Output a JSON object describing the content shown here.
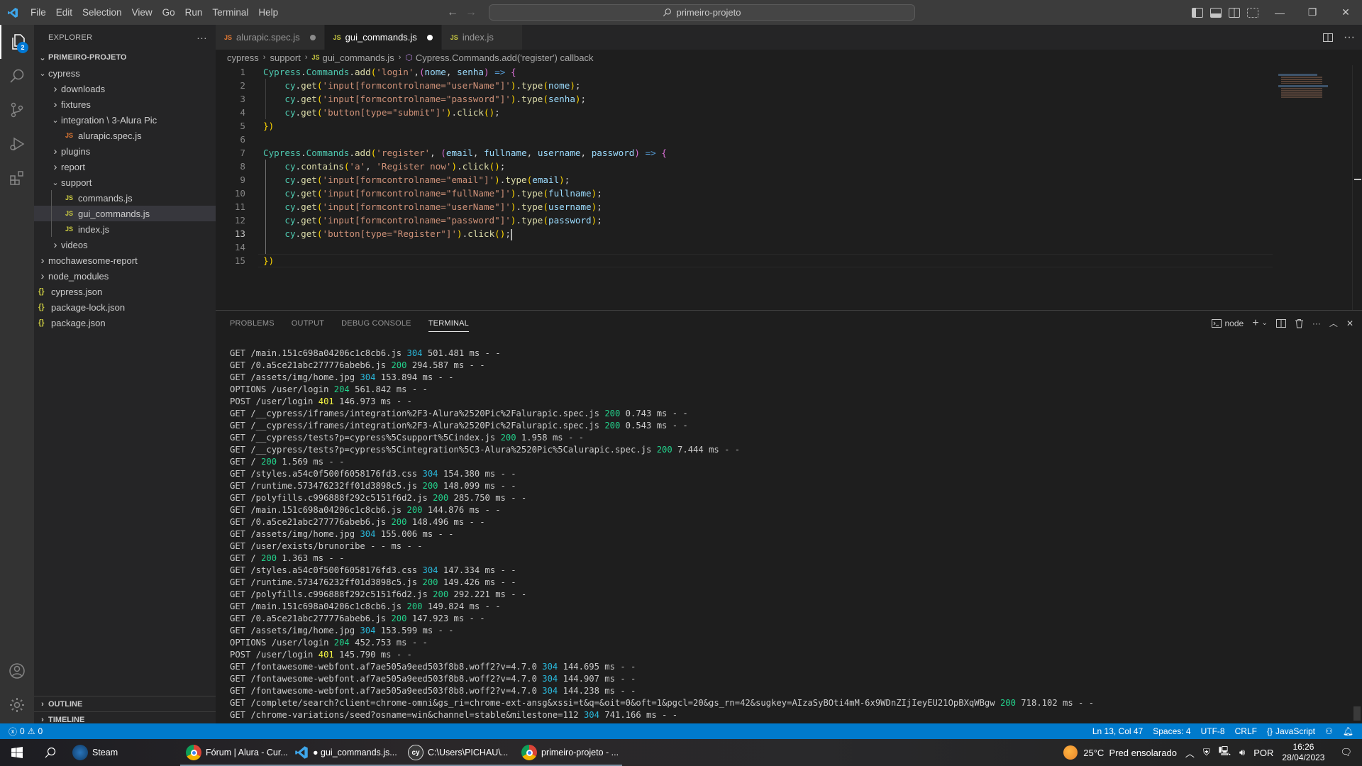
{
  "titlebar": {
    "menu": [
      "File",
      "Edit",
      "Selection",
      "View",
      "Go",
      "Run",
      "Terminal",
      "Help"
    ],
    "search_text": "primeiro-projeto"
  },
  "activity": {
    "explorer_badge": "2"
  },
  "sidebar": {
    "title": "EXPLORER",
    "more": "···",
    "root": "PRIMEIRO-PROJETO",
    "tree": [
      {
        "label": "cypress",
        "type": "folder-open",
        "depth": 1
      },
      {
        "label": "downloads",
        "type": "folder",
        "depth": 2
      },
      {
        "label": "fixtures",
        "type": "folder",
        "depth": 2
      },
      {
        "label": "integration \\ 3-Alura Pic",
        "type": "folder-open",
        "depth": 2
      },
      {
        "label": "alurapic.spec.js",
        "type": "js-orange",
        "depth": 3
      },
      {
        "label": "plugins",
        "type": "folder",
        "depth": 2
      },
      {
        "label": "report",
        "type": "folder",
        "depth": 2
      },
      {
        "label": "support",
        "type": "folder-open",
        "depth": 2
      },
      {
        "label": "commands.js",
        "type": "js",
        "depth": 3
      },
      {
        "label": "gui_commands.js",
        "type": "js",
        "depth": 3,
        "selected": true
      },
      {
        "label": "index.js",
        "type": "js",
        "depth": 3
      },
      {
        "label": "videos",
        "type": "folder",
        "depth": 2
      },
      {
        "label": "mochawesome-report",
        "type": "folder",
        "depth": 1
      },
      {
        "label": "node_modules",
        "type": "folder",
        "depth": 1
      },
      {
        "label": "cypress.json",
        "type": "json",
        "depth": 1
      },
      {
        "label": "package-lock.json",
        "type": "json",
        "depth": 1
      },
      {
        "label": "package.json",
        "type": "json",
        "depth": 1
      }
    ],
    "outline": "OUTLINE",
    "timeline": "TIMELINE"
  },
  "editor": {
    "tabs": [
      {
        "label": "alurapic.spec.js",
        "modified": true,
        "active": false,
        "icon": "orange"
      },
      {
        "label": "gui_commands.js",
        "modified": true,
        "active": true,
        "icon": "yellow"
      },
      {
        "label": "index.js",
        "modified": false,
        "active": false,
        "icon": "yellow"
      }
    ],
    "breadcrumb": [
      "cypress",
      "support",
      "gui_commands.js",
      "Cypress.Commands.add('register') callback"
    ],
    "current_line": 13,
    "lines": [
      "Cypress.Commands.add('login',(nome, senha) => {",
      "    cy.get('input[formcontrolname=\"userName\"]').type(nome);",
      "    cy.get('input[formcontrolname=\"password\"]').type(senha);",
      "    cy.get('button[type=\"submit\"]').click();",
      "})",
      "",
      "Cypress.Commands.add('register', (email, fullname, username, password) => {",
      "    cy.contains('a', 'Register now').click();",
      "    cy.get('input[formcontrolname=\"email\"]').type(email);",
      "    cy.get('input[formcontrolname=\"fullName\"]').type(fullname);",
      "    cy.get('input[formcontrolname=\"userName\"]').type(username);",
      "    cy.get('input[formcontrolname=\"password\"]').type(password);",
      "    cy.get('button[type=\"Register\"]').click();",
      "",
      "})"
    ]
  },
  "panel": {
    "tabs": [
      "PROBLEMS",
      "OUTPUT",
      "DEBUG CONSOLE",
      "TERMINAL"
    ],
    "active_tab": "TERMINAL",
    "terminal_name": "node",
    "terminal_lines": [
      {
        "pre": "GET /main.151c698a04206c1c8cb6.js ",
        "status": "304",
        "post": " 501.481 ms - -"
      },
      {
        "pre": "GET /0.a5ce21abc277776abeb6.js ",
        "status": "200",
        "post": " 294.587 ms - -"
      },
      {
        "pre": "GET /assets/img/home.jpg ",
        "status": "304",
        "post": " 153.894 ms - -"
      },
      {
        "pre": "OPTIONS /user/login ",
        "status": "204",
        "post": " 561.842 ms - -"
      },
      {
        "pre": "POST /user/login ",
        "status": "401",
        "post": " 146.973 ms - -"
      },
      {
        "pre": "GET /__cypress/iframes/integration%2F3-Alura%2520Pic%2Falurapic.spec.js ",
        "status": "200",
        "post": " 0.743 ms - -"
      },
      {
        "pre": "GET /__cypress/iframes/integration%2F3-Alura%2520Pic%2Falurapic.spec.js ",
        "status": "200",
        "post": " 0.543 ms - -"
      },
      {
        "pre": "GET /__cypress/tests?p=cypress%5Csupport%5Cindex.js ",
        "status": "200",
        "post": " 1.958 ms - -"
      },
      {
        "pre": "GET /__cypress/tests?p=cypress%5Cintegration%5C3-Alura%2520Pic%5Calurapic.spec.js ",
        "status": "200",
        "post": " 7.444 ms - -"
      },
      {
        "pre": "GET / ",
        "status": "200",
        "post": " 1.569 ms - -"
      },
      {
        "pre": "GET /styles.a54c0f500f6058176fd3.css ",
        "status": "304",
        "post": " 154.380 ms - -"
      },
      {
        "pre": "GET /runtime.573476232ff01d3898c5.js ",
        "status": "200",
        "post": " 148.099 ms - -"
      },
      {
        "pre": "GET /polyfills.c996888f292c5151f6d2.js ",
        "status": "200",
        "post": " 285.750 ms - -"
      },
      {
        "pre": "GET /main.151c698a04206c1c8cb6.js ",
        "status": "200",
        "post": " 144.876 ms - -"
      },
      {
        "pre": "GET /0.a5ce21abc277776abeb6.js ",
        "status": "200",
        "post": " 148.496 ms - -"
      },
      {
        "pre": "GET /assets/img/home.jpg ",
        "status": "304",
        "post": " 155.006 ms - -"
      },
      {
        "pre": "GET /user/exists/brunoribe - - ms - -",
        "status": "",
        "post": ""
      },
      {
        "pre": "GET / ",
        "status": "200",
        "post": " 1.363 ms - -"
      },
      {
        "pre": "GET /styles.a54c0f500f6058176fd3.css ",
        "status": "304",
        "post": " 147.334 ms - -"
      },
      {
        "pre": "GET /runtime.573476232ff01d3898c5.js ",
        "status": "200",
        "post": " 149.426 ms - -"
      },
      {
        "pre": "GET /polyfills.c996888f292c5151f6d2.js ",
        "status": "200",
        "post": " 292.221 ms - -"
      },
      {
        "pre": "GET /main.151c698a04206c1c8cb6.js ",
        "status": "200",
        "post": " 149.824 ms - -"
      },
      {
        "pre": "GET /0.a5ce21abc277776abeb6.js ",
        "status": "200",
        "post": " 147.923 ms - -"
      },
      {
        "pre": "GET /assets/img/home.jpg ",
        "status": "304",
        "post": " 153.599 ms - -"
      },
      {
        "pre": "OPTIONS /user/login ",
        "status": "204",
        "post": " 452.753 ms - -"
      },
      {
        "pre": "POST /user/login ",
        "status": "401",
        "post": " 145.790 ms - -"
      },
      {
        "pre": "GET /fontawesome-webfont.af7ae505a9eed503f8b8.woff2?v=4.7.0 ",
        "status": "304",
        "post": " 144.695 ms - -"
      },
      {
        "pre": "GET /fontawesome-webfont.af7ae505a9eed503f8b8.woff2?v=4.7.0 ",
        "status": "304",
        "post": " 144.907 ms - -"
      },
      {
        "pre": "GET /fontawesome-webfont.af7ae505a9eed503f8b8.woff2?v=4.7.0 ",
        "status": "304",
        "post": " 144.238 ms - -"
      },
      {
        "pre": "GET /complete/search?client=chrome-omni&gs_ri=chrome-ext-ansg&xssi=t&q=&oit=0&oft=1&pgcl=20&gs_rn=42&sugkey=AIzaSyBOti4mM-6x9WDnZIjIeyEU21OpBXqWBgw ",
        "status": "200",
        "post": " 718.102 ms - -"
      },
      {
        "pre": "GET /chrome-variations/seed?osname=win&channel=stable&milestone=112 ",
        "status": "304",
        "post": " 741.166 ms - -"
      }
    ]
  },
  "statusbar": {
    "errors": "0",
    "warnings": "0",
    "position": "Ln 13, Col 47",
    "spaces": "Spaces: 4",
    "encoding": "UTF-8",
    "eol": "CRLF",
    "language": "JavaScript"
  },
  "taskbar": {
    "apps": [
      {
        "label": "Steam",
        "icon": "steam-icon",
        "open": false
      },
      {
        "label": "Fórum | Alura - Cur...",
        "icon": "chrome-icon",
        "open": true
      },
      {
        "label": "● gui_commands.js...",
        "icon": "vscode-icon",
        "open": true
      },
      {
        "label": "C:\\Users\\PICHAU\\...",
        "icon": "cypress-icon",
        "open": true
      },
      {
        "label": "primeiro-projeto - ...",
        "icon": "chrome-icon",
        "open": true
      }
    ],
    "weather": "25°C  Pred ensolarado",
    "language": "POR",
    "time": "16:26",
    "date": "28/04/2023"
  }
}
